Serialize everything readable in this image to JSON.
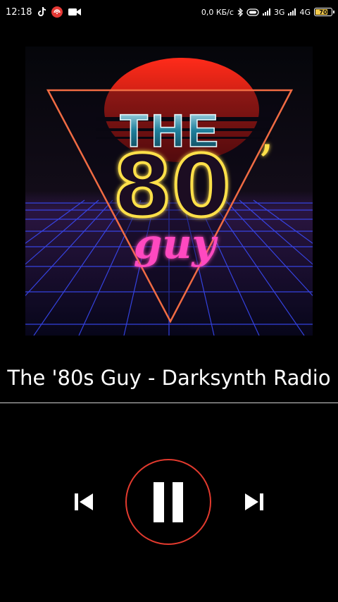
{
  "status_bar": {
    "time": "12:18",
    "network_speed": "0,0 КБ/с",
    "net1": "3G",
    "net2": "4G",
    "battery_level": "70",
    "icons": [
      "tiktok-icon",
      "radio-app-icon",
      "video-camera-icon",
      "bluetooth-icon",
      "data-saver-icon",
      "signal-icon",
      "battery-icon"
    ]
  },
  "cover_art": {
    "text_the": "THE",
    "text_80": "80",
    "text_apostrophe": "’",
    "text_guy": "guy",
    "colors": {
      "sun": "#e3231c",
      "grid": "#3b4cff",
      "triangle": "#f06b43",
      "neon_yellow": "#ffe04a",
      "neon_pink": "#ff49c0"
    }
  },
  "station": {
    "title": "The '80s Guy - Darksynth Radio"
  },
  "controls": {
    "prev": "skip-previous-icon",
    "play_pause": "pause-icon",
    "next": "skip-next-icon",
    "accent": "#e23a2e"
  }
}
